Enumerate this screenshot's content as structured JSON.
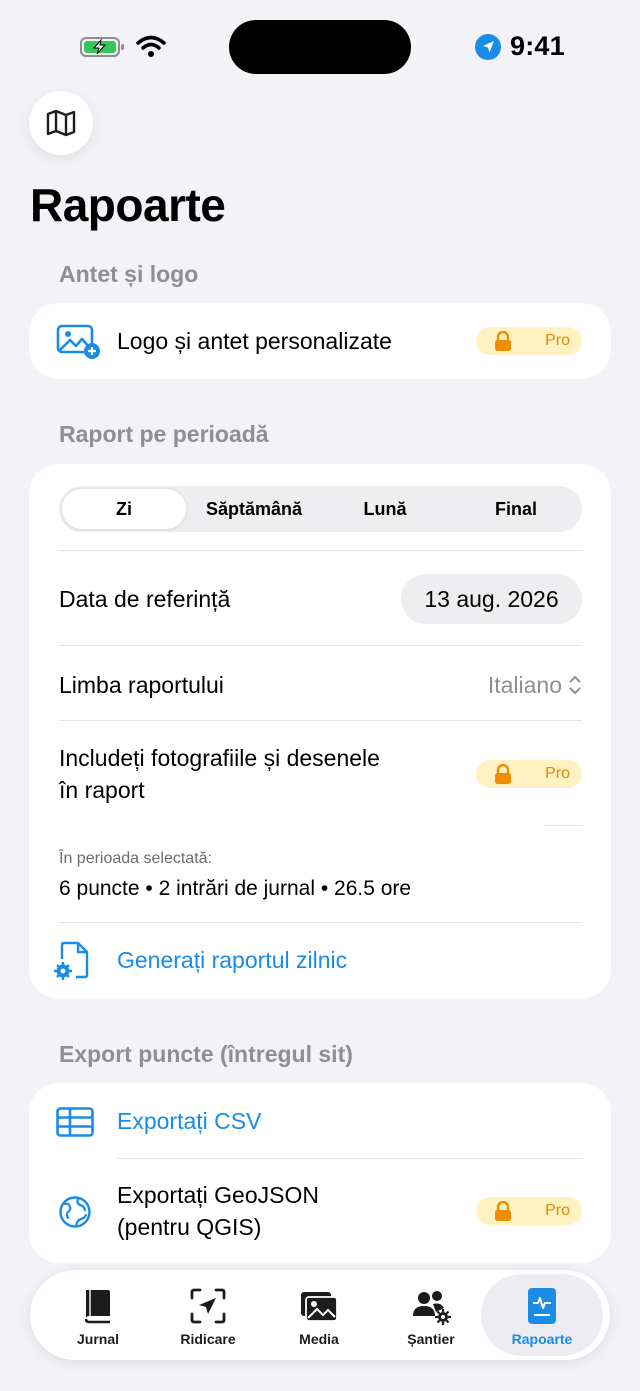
{
  "status_bar": {
    "time": "9:41"
  },
  "page": {
    "title": "Rapoarte"
  },
  "header_section": {
    "title": "Antet și logo",
    "logo_row": {
      "label": "Logo și antet personalizate",
      "badge": "Pro"
    }
  },
  "period_section": {
    "title": "Raport pe perioadă",
    "segments": [
      "Zi",
      "Săptămână",
      "Lună",
      "Final"
    ],
    "selected_segment": "Zi",
    "reference_date": {
      "label": "Data de referință",
      "value": "13 aug. 2026"
    },
    "language": {
      "label": "Limba raportului",
      "value": "Italiano"
    },
    "photos": {
      "label_line1": "Includeți fotografiile și desenele",
      "label_line2": "în raport",
      "badge": "Pro"
    },
    "summary": {
      "caption": "În perioada selectată:",
      "stats": "6 puncte • 2 intrări de jurnal • 26.5 ore"
    },
    "generate_label": "Generați raportul zilnic"
  },
  "export_section": {
    "title": "Export puncte (întregul sit)",
    "csv_label": "Exportați CSV",
    "geojson": {
      "label_line1": "Exportați GeoJSON",
      "label_line2": "(pentru QGIS)",
      "badge": "Pro"
    }
  },
  "tab_bar": {
    "tabs": [
      {
        "label": "Jurnal"
      },
      {
        "label": "Ridicare"
      },
      {
        "label": "Media"
      },
      {
        "label": "Șantier"
      },
      {
        "label": "Rapoarte"
      }
    ],
    "active": "Rapoarte"
  },
  "colors": {
    "accent": "#1A8CE6",
    "pro_badge_bg": "#FFF1C2",
    "pro_text": "#E08A00",
    "background": "#F2F2F7"
  }
}
